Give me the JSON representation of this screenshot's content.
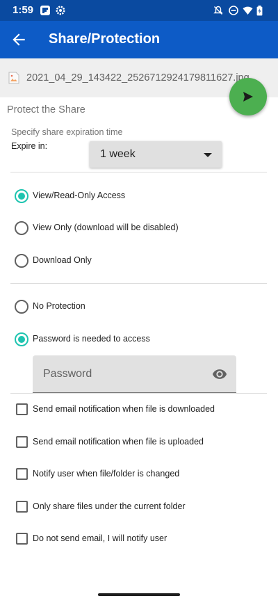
{
  "status_bar": {
    "time": "1:59",
    "icons_left": [
      "flipboard-icon",
      "settings-gear-icon"
    ],
    "icons_right": [
      "mute-icon",
      "do-not-disturb-icon",
      "wifi-icon",
      "battery-icon"
    ]
  },
  "app_bar": {
    "title": "Share/Protection",
    "back_icon": "arrow-back-icon"
  },
  "file": {
    "name": "2021_04_29_143422_2526712924179811627.jpg",
    "icon": "image-file-icon"
  },
  "fab": {
    "icon": "send-icon",
    "color": "#4caf50"
  },
  "protect": {
    "section_title": "Protect the Share",
    "expire_hint": "Specify share expiration time",
    "expire_label": "Expire in:",
    "expire_value": "1 week"
  },
  "access_options": [
    {
      "label": "View/Read-Only Access",
      "selected": true
    },
    {
      "label": "View Only (download will be disabled)",
      "selected": false
    },
    {
      "label": "Download Only",
      "selected": false
    }
  ],
  "protection_options": [
    {
      "label": "No Protection",
      "selected": false
    },
    {
      "label": "Password is needed to access",
      "selected": true
    }
  ],
  "password": {
    "placeholder": "Password",
    "value": "",
    "icon": "eye-icon"
  },
  "checkboxes": [
    {
      "label": "Send email notification when file is downloaded",
      "checked": false
    },
    {
      "label": "Send email notification when file is uploaded",
      "checked": false
    },
    {
      "label": "Notify user when file/folder is changed",
      "checked": false
    },
    {
      "label": "Only share files under the current folder",
      "checked": false
    },
    {
      "label": "Do not send email, I will notify user",
      "checked": false
    }
  ],
  "colors": {
    "status_bar": "#0a4aa0",
    "app_bar": "#0d5bc6",
    "accent": "#1ec4b0"
  }
}
